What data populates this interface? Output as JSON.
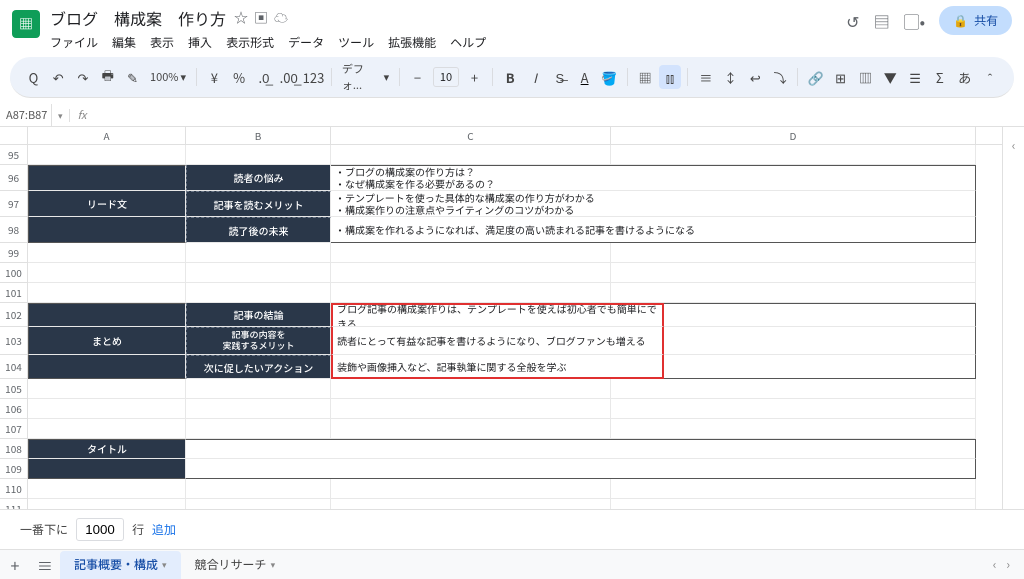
{
  "doc_title": "ブログ　構成案　作り方",
  "menus": [
    "ファイル",
    "編集",
    "表示",
    "挿入",
    "表示形式",
    "データ",
    "ツール",
    "拡張機能",
    "ヘルプ"
  ],
  "share_label": "共有",
  "zoom": "100%",
  "currency": "¥",
  "percent": "%",
  "font_name": "デフォ...",
  "font_size": "10",
  "ja_toggle": "あ",
  "name_box": "A87:B87",
  "columns": [
    "A",
    "B",
    "C",
    "D"
  ],
  "first_row_num": 95,
  "blocks": {
    "lead": {
      "cat": "リード文",
      "rows": [
        {
          "label": "読者の悩み",
          "text": "・ブログの構成案の作り方は？\n・なぜ構成案を作る必要があるの？"
        },
        {
          "label": "記事を読むメリット",
          "text": "・テンプレートを使った具体的な構成案の作り方がわかる\n・構成案作りの注意点やライティングのコツがわかる"
        },
        {
          "label": "読了後の未来",
          "text": "・構成案を作れるようになれば、満足度の高い読まれる記事を書けるようになる"
        }
      ]
    },
    "summary": {
      "cat": "まとめ",
      "rows": [
        {
          "label": "記事の結論",
          "text": "ブログ記事の構成案作りは、テンプレートを使えば初心者でも簡単にできる"
        },
        {
          "label": "記事の内容を\n実践するメリット",
          "text": "読者にとって有益な記事を書けるようになり、ブログファンも増える",
          "twoLine": true
        },
        {
          "label": "次に促したいアクション",
          "text": "装飾や画像挿入など、記事執筆に関する全般を学ぶ"
        }
      ]
    },
    "title_block": {
      "cat": "タイトル"
    }
  },
  "add_rows": {
    "prefix": "一番下に",
    "value": "1000",
    "suffix": "行",
    "link": "追加"
  },
  "tabs": [
    {
      "label": "記事概要・構成",
      "active": true
    },
    {
      "label": "競合リサーチ",
      "active": false
    }
  ]
}
